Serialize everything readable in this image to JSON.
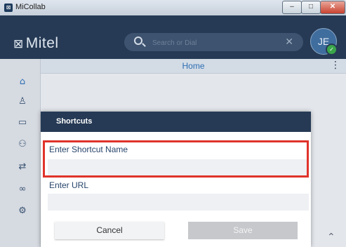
{
  "window": {
    "title": "MiCollab",
    "min_glyph": "–",
    "max_glyph": "□",
    "close_glyph": "✕"
  },
  "header": {
    "logo_text": "Mitel",
    "logo_mark": "⊠",
    "search": {
      "placeholder": "Search or Dial",
      "value": ""
    },
    "clear_glyph": "✕",
    "avatar_initials": "JE",
    "presence_glyph": "✓"
  },
  "sidebar": {
    "items": [
      {
        "icon": "home-icon",
        "glyph": "⌂",
        "color": "#2d6fb3"
      },
      {
        "icon": "contacts-icon",
        "glyph": "♙"
      },
      {
        "icon": "chat-icon",
        "glyph": "▭"
      },
      {
        "icon": "people-icon",
        "glyph": "⚇"
      },
      {
        "icon": "call-history-icon",
        "glyph": "⇄"
      },
      {
        "icon": "voicemail-icon",
        "glyph": "∞"
      },
      {
        "icon": "settings-icon",
        "glyph": "⚙"
      }
    ]
  },
  "main": {
    "title": "Home",
    "kebab_glyph": "⋮",
    "scroll_glyph": "⌃"
  },
  "dialog": {
    "title": "Shortcuts",
    "name_label": "Enter Shortcut Name",
    "name_value": "",
    "url_label": "Enter URL",
    "url_value": "",
    "cancel_label": "Cancel",
    "save_label": "Save"
  },
  "colors": {
    "header_bg": "#263a55",
    "accent": "#2d6fb3",
    "highlight": "#e0332b"
  }
}
